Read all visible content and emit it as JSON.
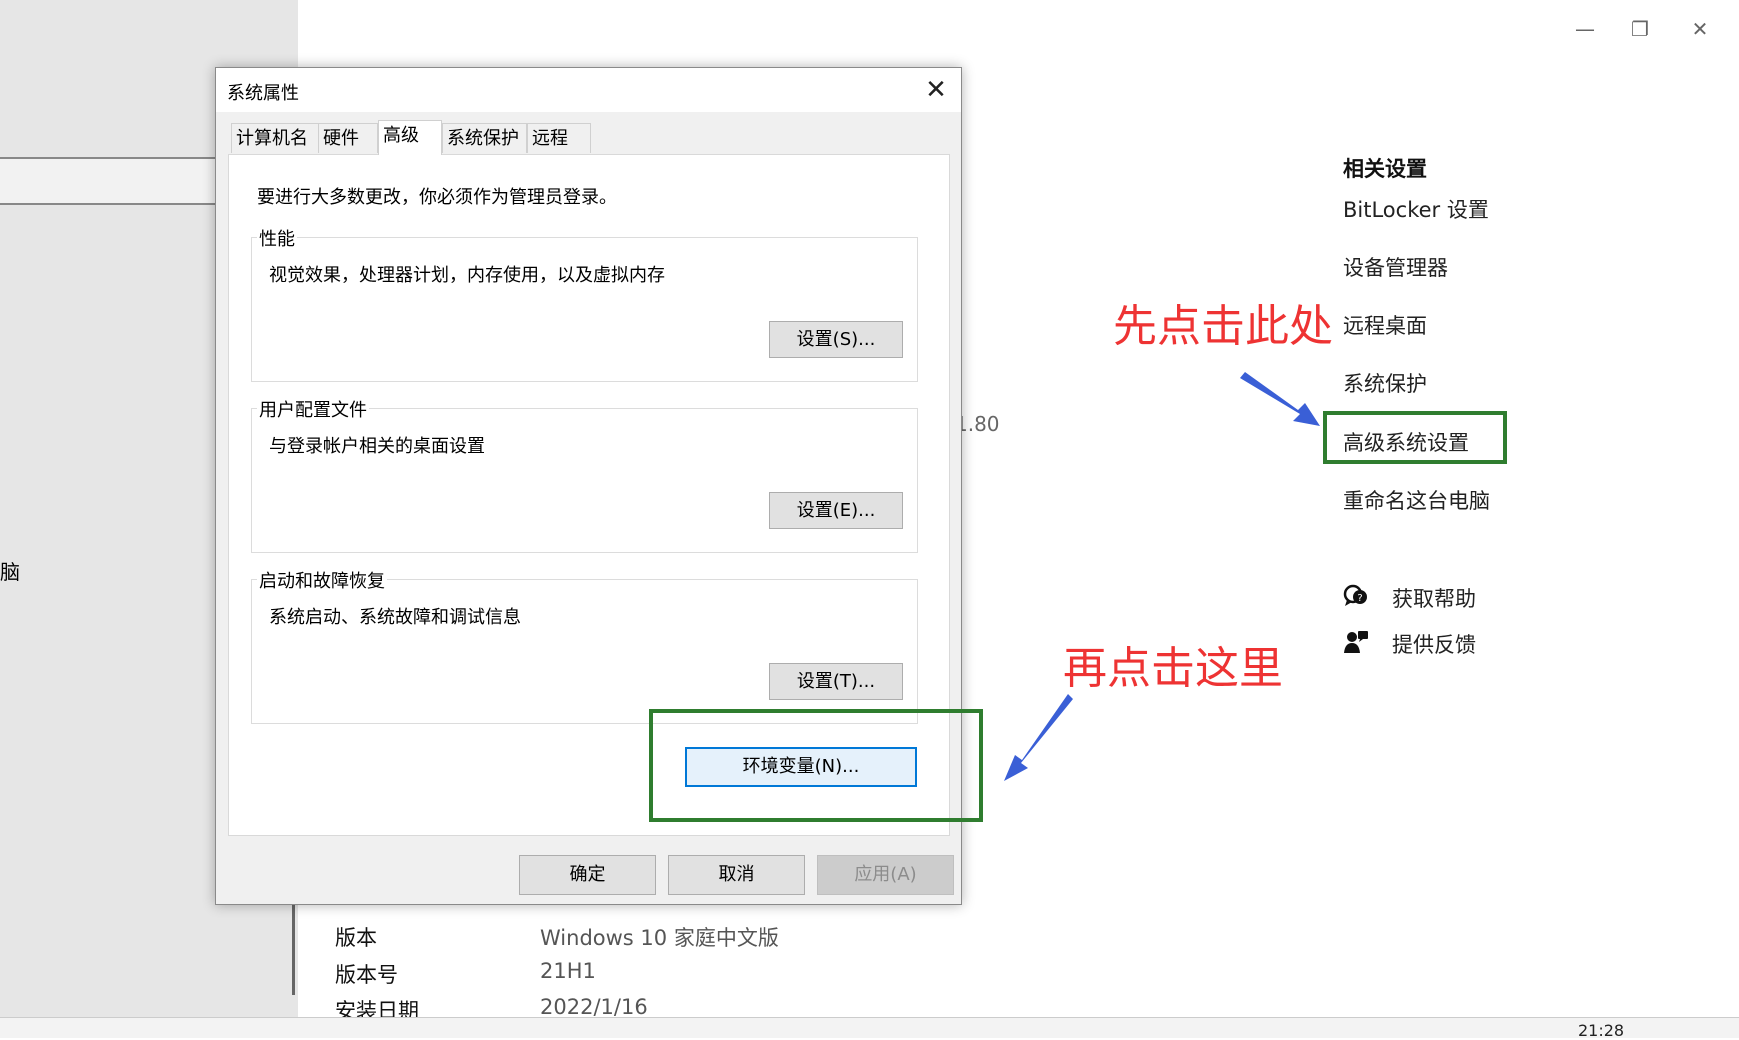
{
  "settings_window": {
    "left_fragment": "脑",
    "controls": {
      "minimize": "—",
      "restore": "❐",
      "close": "✕"
    },
    "related": {
      "title": "相关设置",
      "links": [
        "BitLocker 设置",
        "设备管理器",
        "远程桌面",
        "系统保护",
        "高级系统设置",
        "重命名这台电脑"
      ]
    },
    "help": {
      "get_help": "获取帮助",
      "feedback": "提供反馈"
    },
    "version_fragment": "1.80",
    "info": [
      {
        "label": "版本",
        "value": "Windows 10 家庭中文版"
      },
      {
        "label": "版本号",
        "value": "21H1"
      },
      {
        "label": "安装日期",
        "value": "2022/1/16"
      }
    ],
    "taskbar_time": "21:28"
  },
  "annotations": {
    "first": "先点击此处",
    "second": "再点击这里",
    "colors": {
      "text": "#ee3333",
      "box": "#2f7d2f",
      "arrow": "#3a5fd6"
    }
  },
  "dialog": {
    "title": "系统属性",
    "close": "✕",
    "tabs": [
      "计算机名",
      "硬件",
      "高级",
      "系统保护",
      "远程"
    ],
    "active_tab": "高级",
    "admin_note": "要进行大多数更改，你必须作为管理员登录。",
    "groups": [
      {
        "title": "性能",
        "desc": "视觉效果，处理器计划，内存使用，以及虚拟内存",
        "button": "设置(S)..."
      },
      {
        "title": "用户配置文件",
        "desc": "与登录帐户相关的桌面设置",
        "button": "设置(E)..."
      },
      {
        "title": "启动和故障恢复",
        "desc": "系统启动、系统故障和调试信息",
        "button": "设置(T)..."
      }
    ],
    "env_button": "环境变量(N)...",
    "ok": "确定",
    "cancel": "取消",
    "apply": "应用(A)"
  }
}
